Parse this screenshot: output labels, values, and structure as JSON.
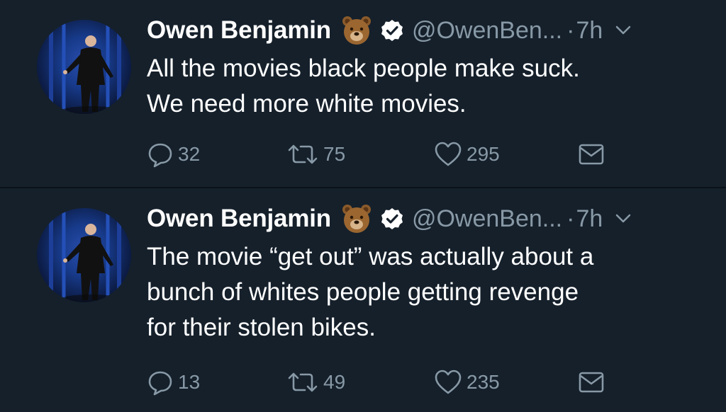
{
  "tweets": [
    {
      "display_name": "Owen Benjamin",
      "emoji_icon": "bear-face-icon",
      "handle": "@OwenBen...",
      "dot": "·",
      "time": "7h",
      "lines": [
        "All the movies black people make suck.",
        "We need more white movies."
      ],
      "replies": "32",
      "retweets": "75",
      "likes": "295"
    },
    {
      "display_name": "Owen Benjamin",
      "emoji_icon": "bear-face-icon",
      "handle": "@OwenBen...",
      "dot": "·",
      "time": "7h",
      "lines": [
        "The movie “get out” was actually about a",
        "bunch of whites people getting revenge",
        "for their stolen bikes."
      ],
      "replies": "13",
      "retweets": "49",
      "likes": "235"
    }
  ],
  "colors": {
    "background": "#15202b",
    "text": "#ffffff",
    "muted": "#8899a6",
    "divider": "#0b1118"
  }
}
